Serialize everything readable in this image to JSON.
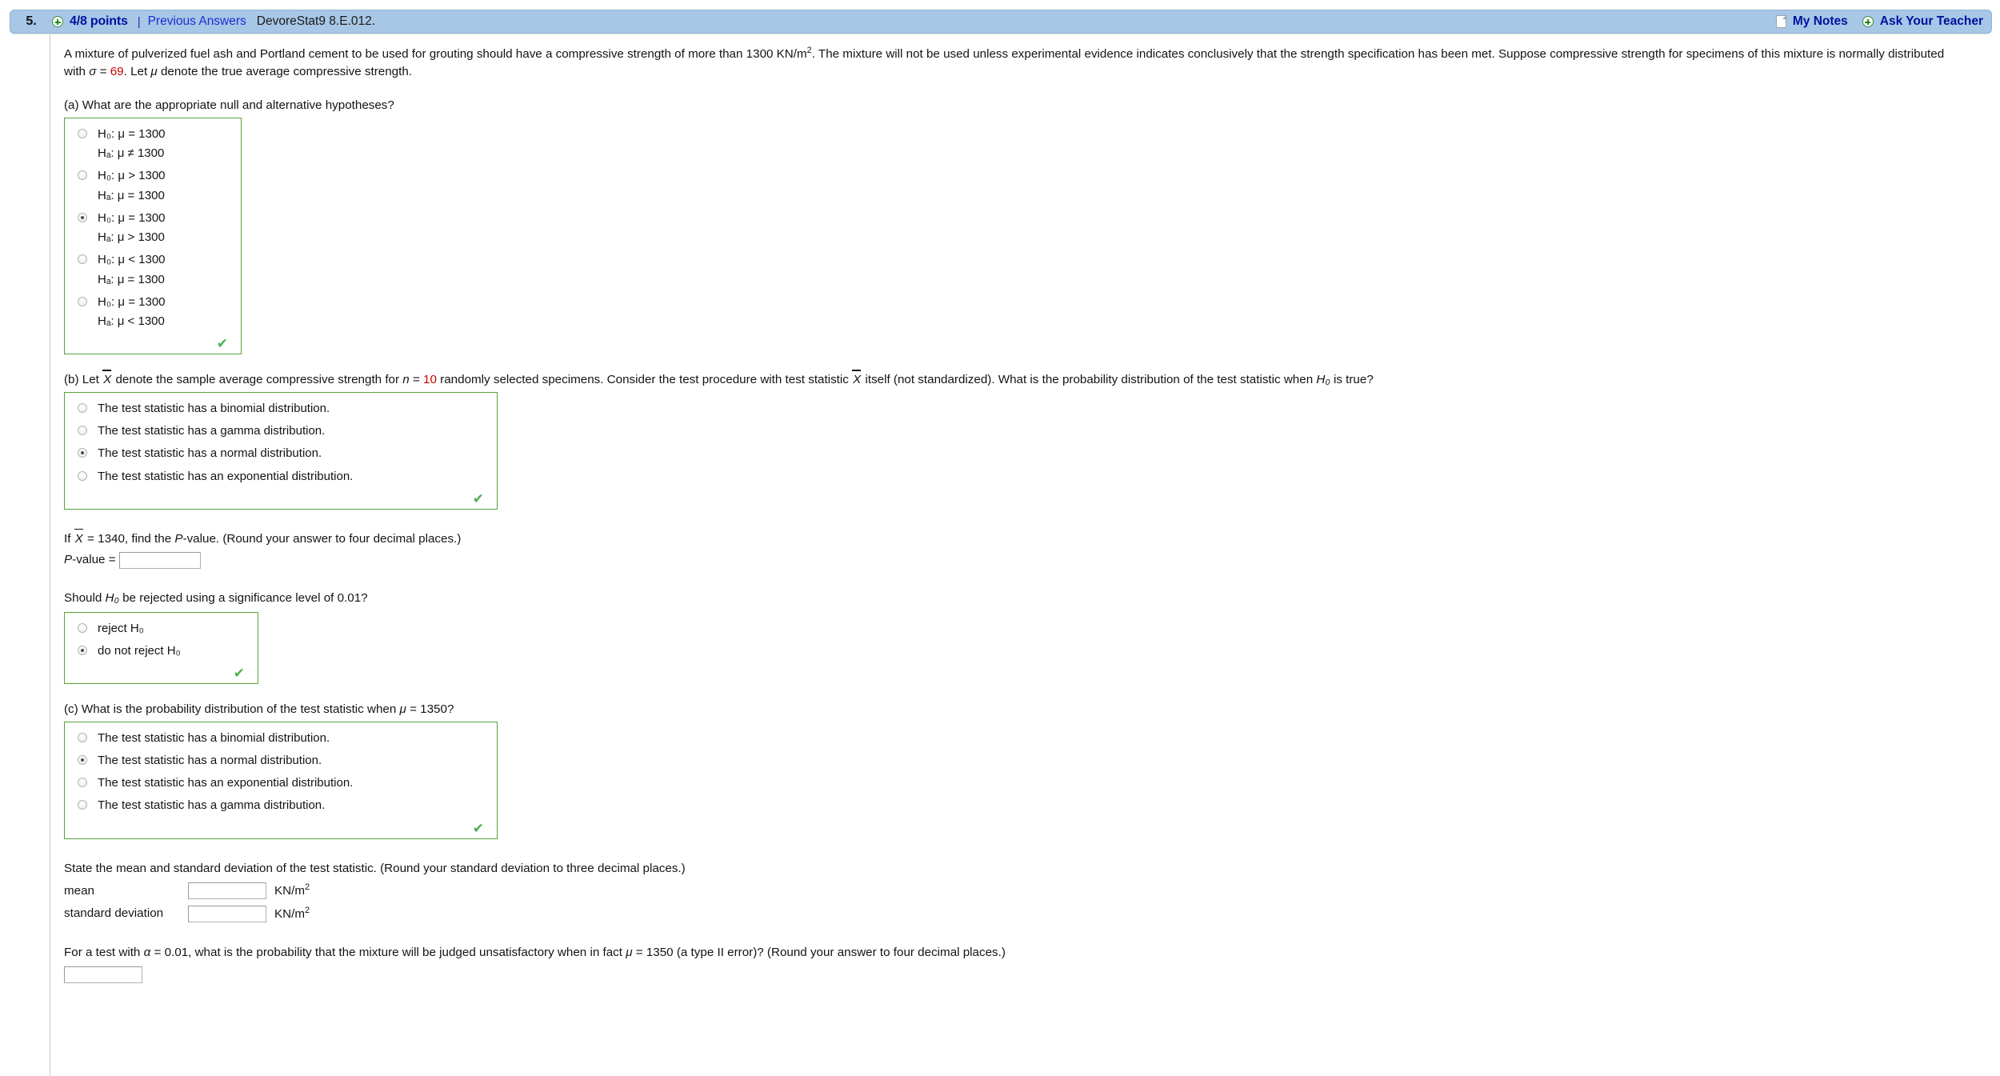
{
  "header": {
    "question_number": "5.",
    "points": "4/8 points",
    "separator": "|",
    "previous_answers": "Previous Answers",
    "question_code": "DevoreStat9 8.E.012.",
    "my_notes": "My Notes",
    "ask_your_teacher": "Ask Your Teacher",
    "bar_color": "#a8c6e5",
    "link_color": "#00119e"
  },
  "problem": {
    "text_1": "A mixture of pulverized fuel ash and Portland cement to be used for grouting should have a compressive strength of more than 1300 KN/m",
    "exp_1": "2",
    "text_2": ". The mixture will not be used unless experimental evidence indicates conclusively that the strength specification has been met. Suppose compressive strength for specimens of this mixture is normally distributed with ",
    "sigma_symbol": "σ",
    "eq": " = ",
    "sigma_value": "69",
    "text_3": ". Let ",
    "mu_symbol": "μ",
    "text_4": " denote the true average compressive strength."
  },
  "part_a": {
    "question": "(a) What are the appropriate null and alternative hypotheses?",
    "options": [
      {
        "line1": "H₀: μ = 1300",
        "line2": "Hₐ: μ ≠ 1300",
        "selected": false
      },
      {
        "line1": "H₀: μ > 1300",
        "line2": "Hₐ: μ = 1300",
        "selected": false
      },
      {
        "line1": "H₀: μ = 1300",
        "line2": "Hₐ: μ > 1300",
        "selected": true
      },
      {
        "line1": "H₀: μ < 1300",
        "line2": "Hₐ: μ = 1300",
        "selected": false
      },
      {
        "line1": "H₀: μ = 1300",
        "line2": "Hₐ: μ < 1300",
        "selected": false
      }
    ],
    "correct_mark": "✔"
  },
  "part_b": {
    "q_text_1": "(b) Let ",
    "q_xbar": "X",
    "q_text_2": " denote the sample average compressive strength for ",
    "q_n": "n",
    "q_eq": " = ",
    "q_n_value": "10",
    "q_text_3": " randomly selected specimens. Consider the test procedure with test statistic ",
    "q_xbar2": "X",
    "q_text_4": " itself (not standardized). What is the probability distribution of the test statistic when ",
    "q_h0": "H₀",
    "q_text_5": " is true?",
    "options": [
      {
        "label": "The test statistic has a binomial distribution.",
        "selected": false
      },
      {
        "label": "The test statistic has a gamma distribution.",
        "selected": false
      },
      {
        "label": "The test statistic has a normal distribution.",
        "selected": true
      },
      {
        "label": "The test statistic has an exponential distribution.",
        "selected": false
      }
    ],
    "correct_mark": "✔",
    "pvalue_question_1": "If ",
    "pvalue_xbar": "X",
    "pvalue_question_2": " = 1340,  find the ",
    "pvalue_italic_p": "P",
    "pvalue_question_3": "-value. (Round your answer to four decimal places.)",
    "pvalue_label_p": "P",
    "pvalue_label_rest": "-value = ",
    "pvalue_input_value": "",
    "reject_question_1": "Should ",
    "reject_question_h0": "H₀",
    "reject_question_2": " be rejected using a significance level of 0.01?",
    "reject_options": [
      {
        "label": "reject H₀",
        "selected": false
      },
      {
        "label": "do not reject H₀",
        "selected": true
      }
    ],
    "reject_correct_mark": "✔"
  },
  "part_c": {
    "q_text_1": "(c) What is the probability distribution of the test statistic when ",
    "q_mu": "μ",
    "q_text_2": " = 1350?",
    "options": [
      {
        "label": "The test statistic has a binomial distribution.",
        "selected": false
      },
      {
        "label": "The test statistic has a normal distribution.",
        "selected": true
      },
      {
        "label": "The test statistic has an exponential distribution.",
        "selected": false
      },
      {
        "label": "The test statistic has a gamma distribution.",
        "selected": false
      }
    ],
    "correct_mark": "✔",
    "state_question": "State the mean and standard deviation of the test statistic. (Round your standard deviation to three decimal places.)",
    "mean_label": "mean",
    "mean_value": "",
    "mean_unit": "KN/m",
    "mean_unit_exp": "2",
    "sd_label": "standard deviation",
    "sd_value": "",
    "sd_unit": "KN/m",
    "sd_unit_exp": "2",
    "type2_text_1": "For a test with ",
    "type2_alpha": "α",
    "type2_text_2": " = 0.01, what is the probability that the mixture will be judged unsatisfactory when in fact ",
    "type2_mu": "μ",
    "type2_text_3": " = 1350 (a type II error)? (Round your answer to four decimal places.)",
    "type2_input_value": ""
  }
}
